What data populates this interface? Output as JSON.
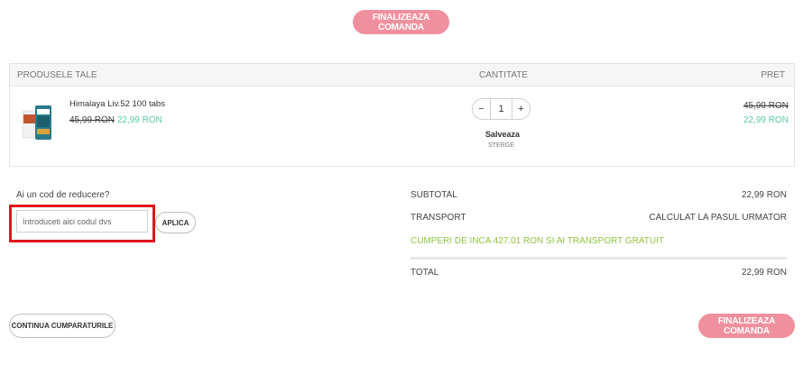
{
  "top_button": {
    "label": "FINALIZEAZA COMANDA"
  },
  "cart": {
    "headers": {
      "products": "PRODUSELE TALE",
      "quantity": "CANTITATE",
      "price": "PRET"
    },
    "item": {
      "name": "Himalaya Liv.52 100 tabs",
      "old_price": "45,99 RON",
      "new_price": "22,99 RON",
      "quantity": "1",
      "minus": "−",
      "plus": "+",
      "save_label": "Salveaza",
      "remove_label": "STERGE",
      "total_old": "45,99 RON",
      "total_new": "22,99 RON"
    }
  },
  "discount": {
    "label": "Ai un cod de reducere?",
    "placeholder": "Introduceti aici codul dvs",
    "apply_label": "APLICA"
  },
  "summary": {
    "subtotal_label": "SUBTOTAL",
    "subtotal_value": "22,99 RON",
    "transport_label": "TRANSPORT",
    "transport_value": "CALCULAT LA PASUL URMATOR",
    "free_shipping_msg": "CUMPERI DE INCA 427.01 RON SI AI TRANSPORT GRATUIT",
    "total_label": "TOTAL",
    "total_value": "22,99 RON"
  },
  "footer": {
    "continue_label": "CONTINUA CUMPARATURILE",
    "checkout_label": "FINALIZEAZA COMANDA"
  }
}
